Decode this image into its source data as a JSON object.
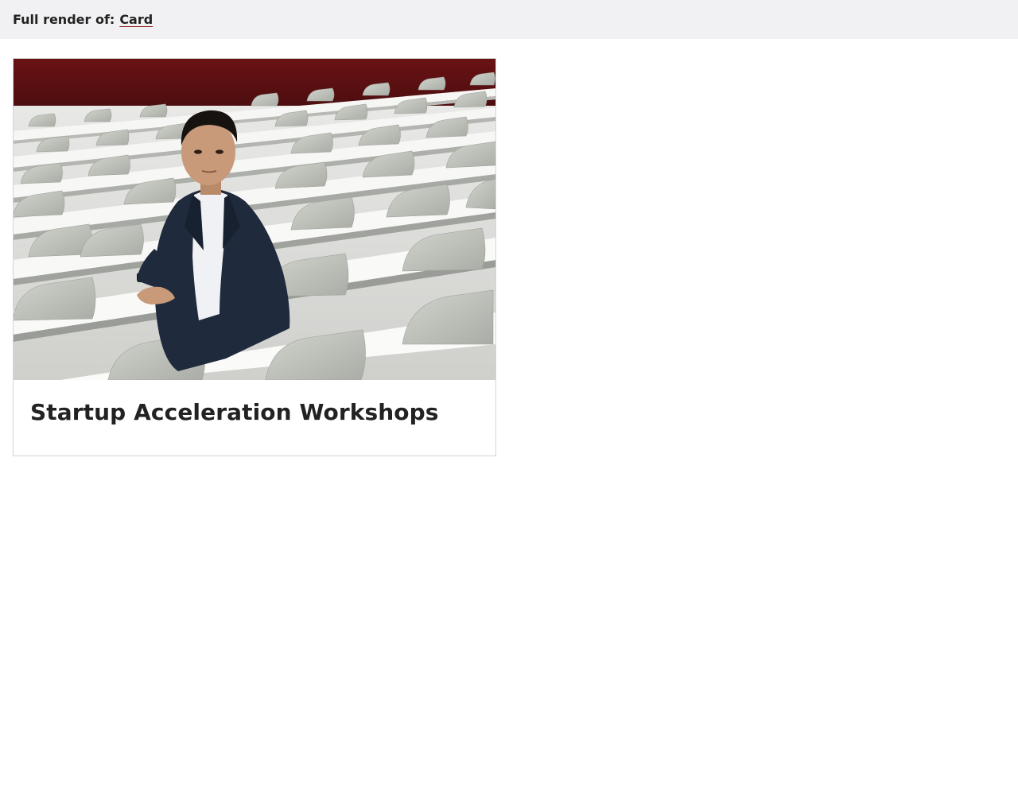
{
  "header": {
    "prefix": "Full render of:",
    "link_label": "Card"
  },
  "card": {
    "title": "Startup Acceleration Workshops",
    "image": {
      "subject": "photo-man-in-lecture-hall",
      "colors": {
        "wall": "#5a1012",
        "desk": "#f3f3f1",
        "chair": "#c3c6bf",
        "jacket": "#1f2a3d",
        "shirt": "#f2f2f4",
        "skin": "#c89a7a",
        "hair": "#16120f"
      }
    }
  },
  "colors": {
    "topbar_bg": "#f1f1f3",
    "link_underline": "#8b1a1a",
    "card_border": "#d4d4d4",
    "text": "#222222"
  }
}
